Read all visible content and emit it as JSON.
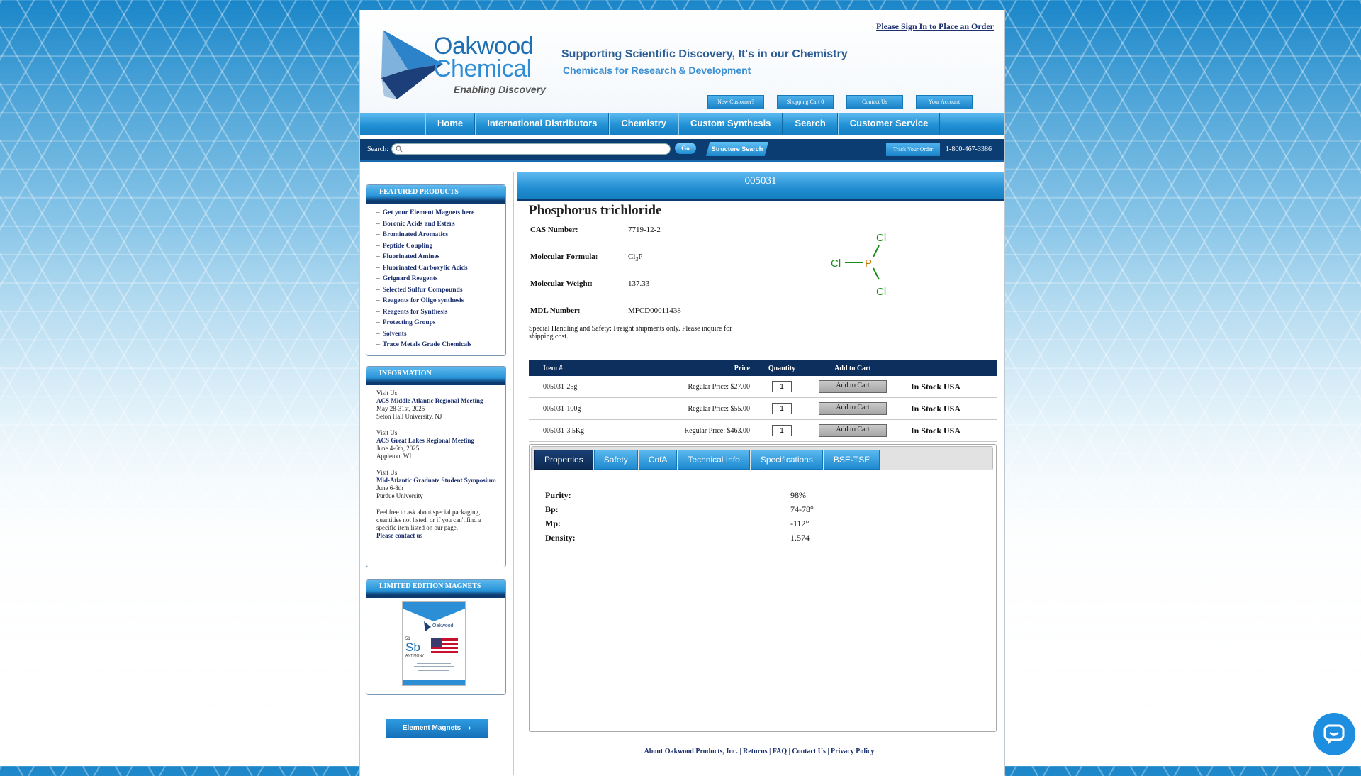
{
  "header": {
    "logo_line1": "Oakwood",
    "logo_line2": "Chemical",
    "logo_tagline": "Enabling Discovery",
    "tagline1": "Supporting Scientific Discovery, It's in our Chemistry",
    "tagline2": "Chemicals for Research & Development",
    "signin": "Please Sign In to Place an Order",
    "top_links": [
      "New Customer?",
      "Shopping Cart 0",
      "Contact Us",
      "Your Account"
    ]
  },
  "nav": [
    "Home",
    "International Distributors",
    "Chemistry",
    "Custom Synthesis",
    "Search",
    "Customer Service"
  ],
  "search": {
    "label": "Search:",
    "value": "",
    "go": "Go",
    "structure_search": "Structure Search",
    "track_order": "Track Your Order",
    "phone": "1-800-467-3386"
  },
  "sidebar": {
    "featured_title": "FEATURED PRODUCTS",
    "featured_items": [
      "Get your Element Magnets here",
      "Boronic Acids and Esters",
      "Brominated Aromatics",
      "Peptide Coupling",
      "Fluorinated Amines",
      "Fluorinated Carboxylic Acids",
      "Grignard Reagents",
      "Selected Sulfur Compounds",
      "Reagents for Oligo synthesis",
      "Reagents for Synthesis",
      "Protecting Groups",
      "Solvents",
      "Trace Metals Grade Chemicals"
    ],
    "info_title": "INFORMATION",
    "events": [
      {
        "visit": "Visit Us:",
        "name": "ACS Middle Atlantic Regional Meeting",
        "date": "May 28-31st, 2025",
        "place": "Seton Hall University, NJ"
      },
      {
        "visit": "Visit Us:",
        "name": "ACS Great Lakes Regional Meeting",
        "date": "June 4-6th, 2025",
        "place": "Appleton, WI"
      },
      {
        "visit": "Visit Us:",
        "name": "Mid-Atlantic Graduate Student Symposium",
        "date": "June 6-8th",
        "place": "Purdue University"
      }
    ],
    "info_note": "Feel free to ask about special packaging, quantities not listed, or if you can't find a specific item listed on our page.",
    "contact_link": "Please contact us",
    "magnets_title": "LIMITED EDITION MAGNETS",
    "magnet_element_symbol": "Sb",
    "magnet_element_number": "51",
    "magnet_element_name": "ANTIMONY",
    "element_magnets_btn": "Element Magnets"
  },
  "product": {
    "code": "005031",
    "name": "Phosphorus trichloride",
    "props": [
      {
        "label": "CAS Number:",
        "value": "7719-12-2"
      },
      {
        "label": "Molecular Formula:",
        "value": "Cl3P"
      },
      {
        "label": "Molecular Weight:",
        "value": "137.33"
      },
      {
        "label": "MDL Number:",
        "value": "MFCD00011438"
      }
    ],
    "formula_main": "Cl",
    "formula_sub": "3",
    "formula_tail": "P",
    "handling": "Special Handling and Safety: Freight shipments only. Please inquire for shipping cost.",
    "structure_atoms": {
      "center": "P",
      "ligand": "Cl"
    }
  },
  "table": {
    "headers": [
      "Item #",
      "Price",
      "Quantity",
      "Add to Cart"
    ],
    "rows": [
      {
        "item": "005031-25g",
        "price": "Regular Price: $27.00",
        "qty": "1",
        "btn": "Add to Cart",
        "stock": "In Stock USA"
      },
      {
        "item": "005031-100g",
        "price": "Regular Price: $55.00",
        "qty": "1",
        "btn": "Add to Cart",
        "stock": "In Stock USA"
      },
      {
        "item": "005031-3.5Kg",
        "price": "Regular Price: $463.00",
        "qty": "1",
        "btn": "Add to Cart",
        "stock": "In Stock USA"
      }
    ]
  },
  "tabs": [
    "Properties",
    "Safety",
    "CofA",
    "Technical Info",
    "Specifications",
    "BSE-TSE"
  ],
  "active_tab": "Properties",
  "specs": [
    {
      "label": "Purity:",
      "value": "98%"
    },
    {
      "label": "Bp:",
      "value": "74-78°"
    },
    {
      "label": "Mp:",
      "value": "-112°"
    },
    {
      "label": "Density:",
      "value": "1.574"
    }
  ],
  "footer": [
    "About Oakwood Products, Inc.",
    "Returns",
    "FAQ",
    "Contact Us",
    "Privacy Policy"
  ],
  "colors": {
    "accent": "#2190d4",
    "dark_navy": "#0d2f5d",
    "stock_red": "#e00000",
    "link": "#1b2f6e"
  },
  "icons": {
    "search": "search-icon",
    "chat": "chat-icon",
    "chevron": "chevron-right-icon"
  }
}
